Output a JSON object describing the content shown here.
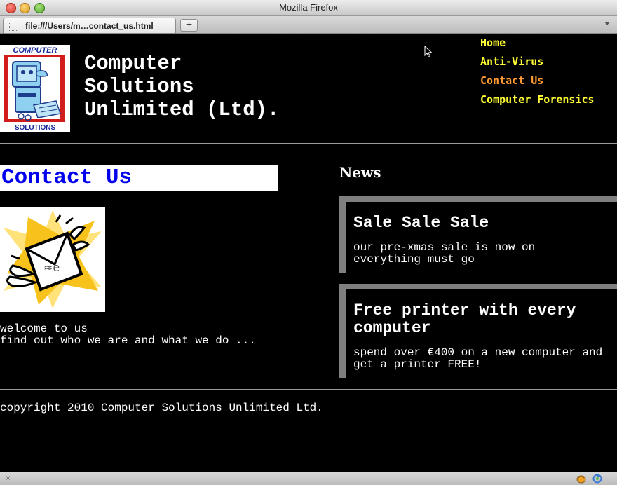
{
  "window": {
    "title": "Mozilla Firefox"
  },
  "tab": {
    "label": "file:///Users/m…contact_us.html",
    "new_tab": "+"
  },
  "site": {
    "title_lines": [
      "Computer",
      "Solutions",
      "Unlimited (Ltd)."
    ],
    "logo": {
      "top_text": "COMPUTER",
      "bottom_text": "SOLUTIONS"
    },
    "nav": [
      {
        "label": "Home",
        "active": false
      },
      {
        "label": "Anti-Virus",
        "active": false
      },
      {
        "label": "Contact Us",
        "active": true
      },
      {
        "label": "Computer Forensics",
        "active": false
      }
    ],
    "nav_color": "#ffff33",
    "nav_active_color": "#ff9933"
  },
  "main": {
    "heading": "Contact Us",
    "heading_color": "#0000ee",
    "intro_lines": [
      "welcome to us",
      "find out who we are and what we do ..."
    ]
  },
  "news": {
    "title": "News",
    "items": [
      {
        "title": "Sale Sale Sale",
        "body_lines": [
          "our pre-xmas sale is now on",
          "everything must go"
        ]
      },
      {
        "title_lines": [
          "Free printer with every",
          "computer"
        ],
        "body_lines": [
          "spend over €400 on a new computer and",
          "get a printer FREE!"
        ]
      }
    ]
  },
  "footer": {
    "copyright": "copyright 2010 Computer Solutions Unlimited Ltd."
  },
  "statusbar": {
    "left_glyph": "×"
  }
}
